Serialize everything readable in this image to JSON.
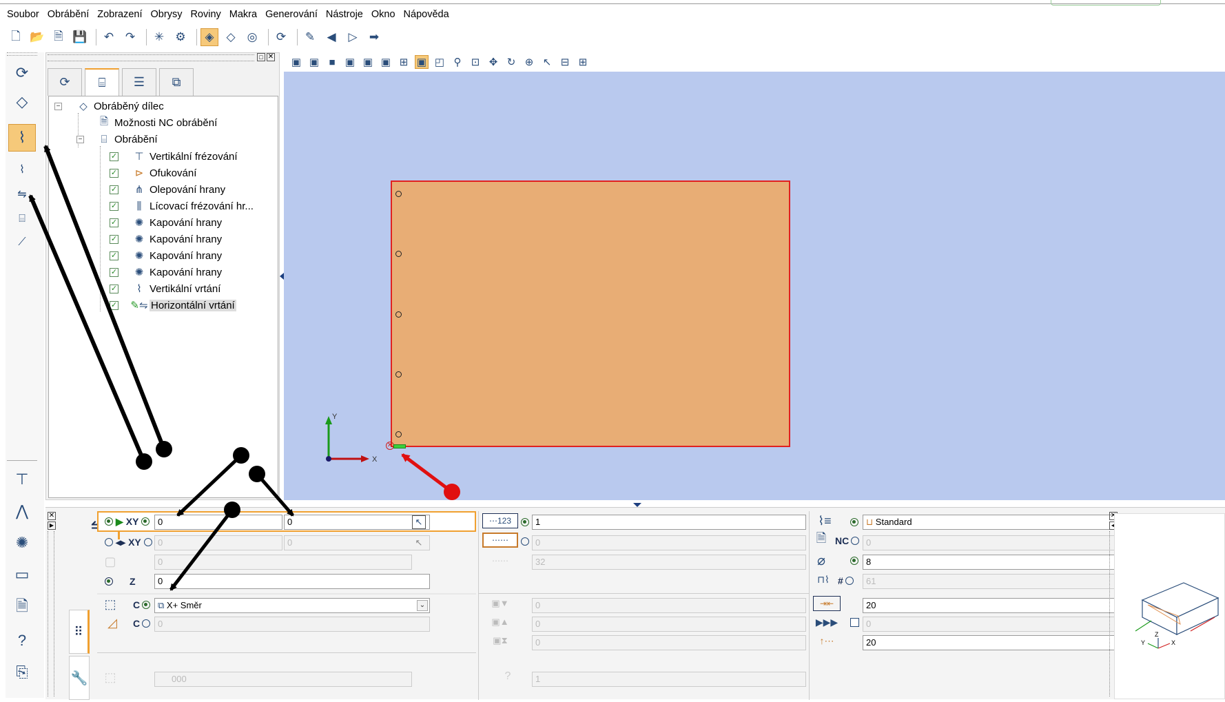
{
  "menu": [
    "Soubor",
    "Obrábění",
    "Zobrazení",
    "Obrysy",
    "Roviny",
    "Makra",
    "Generování",
    "Nástroje",
    "Okno",
    "Nápověda"
  ],
  "toolbar_icons": [
    "new-icon",
    "open-icon",
    "new-template-icon",
    "save-icon",
    "undo-icon",
    "redo-icon",
    "new-part-icon",
    "settings-icon",
    "view-3d-solid-icon",
    "view-3d-icon",
    "view-3d-wire-icon",
    "refresh-icon",
    "edit-icon",
    "arrow-left-icon",
    "play-icon",
    "arrow-right-icon"
  ],
  "tree": {
    "root": "Obráběný dílec",
    "nc_options": "Možnosti NC obrábění",
    "machining": "Obrábění",
    "operations": [
      "Vertikální frézování",
      "Ofukování",
      "Olepování hrany",
      "Lícovací frézování hr...",
      "Kapování hrany",
      "Kapování hrany",
      "Kapování hrany",
      "Kapování hrany",
      "Vertikální vrtání",
      "Horizontální vrtání"
    ],
    "check_mark": "✓"
  },
  "axis": {
    "x": "X",
    "y": "Y",
    "z": "Z"
  },
  "params": {
    "xy_label": "XY",
    "xy1_val": "0",
    "xy1_val2": "0",
    "xy2_val": "0",
    "xy2_val2": "0",
    "row3_val": "0",
    "z_label": "Z",
    "z_val": "0",
    "c_label": "C",
    "c_val": "X+ Směr",
    "c2_label": "C",
    "c2_val": "0",
    "bottom_val": "000",
    "mid1_val": "1",
    "mid2_val": "0",
    "mid3_val": "32",
    "mid5_val": "0",
    "mid6_val": "0",
    "mid7_val": "0",
    "mid_bottom_val": "1",
    "r1_val": "Standard",
    "nc_label": "NC",
    "r2_val": "0",
    "r3_val": "8",
    "hash_label": "#",
    "r4_val": "61",
    "r4_btn": "...",
    "r5_val": "20",
    "r6_val": "0",
    "r7_val": "20"
  },
  "colors": {
    "part_fill": "#e8ad75",
    "part_border": "#e02020",
    "viewport": "#b9c9ee",
    "annotation_black": "#000000",
    "annotation_red": "#e01010"
  }
}
